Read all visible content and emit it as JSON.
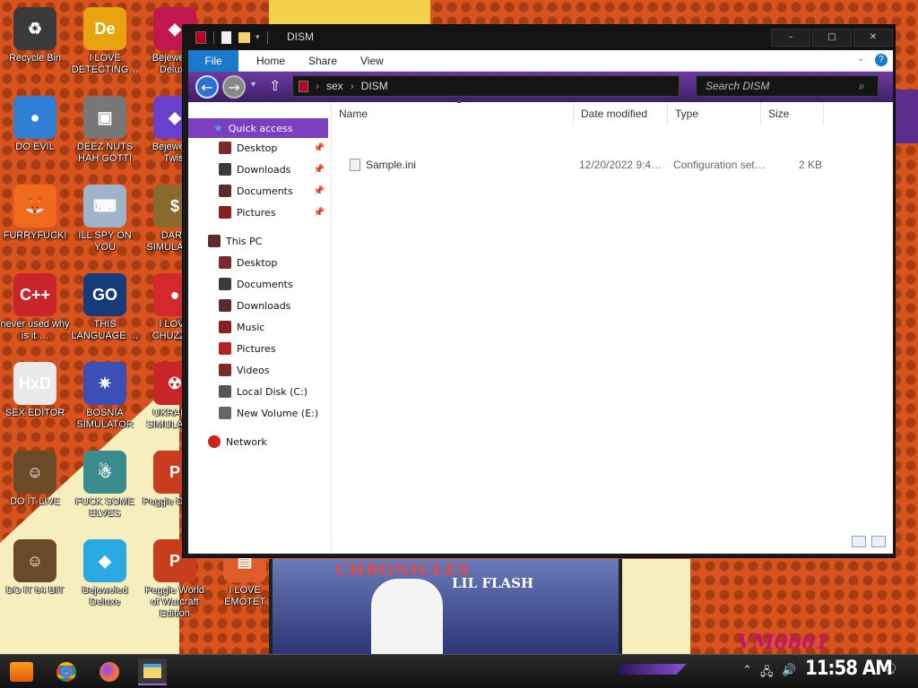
{
  "desktop": {
    "icons": [
      {
        "label": "Recycle Bin",
        "glyph": "♻",
        "color": "#3a3a3a"
      },
      {
        "label": "I LOVE DETECTING…",
        "glyph": "De",
        "color": "#e8a30f"
      },
      {
        "label": "Bejeweled Deluxe",
        "glyph": "◆",
        "color": "#c4164e"
      },
      {
        "label": "DO EVIL",
        "glyph": "●",
        "color": "#2f7fd6"
      },
      {
        "label": "DEEZ NUTS HAH GOTTI",
        "glyph": "▣",
        "color": "#777777"
      },
      {
        "label": "Bejeweled Twist",
        "glyph": "◆",
        "color": "#6a3fc9"
      },
      {
        "label": "FURRYFUCK!",
        "glyph": "🦊",
        "color": "#ef6a1c"
      },
      {
        "label": "ILL SPY ON YOU",
        "glyph": "⌨",
        "color": "#9fb4c8"
      },
      {
        "label": "DARK SIMULATOR",
        "glyph": "$",
        "color": "#8a6a2c"
      },
      {
        "label": "never used why is it …",
        "glyph": "C++",
        "color": "#c8242a"
      },
      {
        "label": "THIS LANGUAGE …",
        "glyph": "GO",
        "color": "#173a7a"
      },
      {
        "label": "I LOVE CHUZZLE",
        "glyph": "●",
        "color": "#d4282c"
      },
      {
        "label": "SEX EDITOR",
        "glyph": "HxD",
        "color": "#e9e9e9"
      },
      {
        "label": "BOSNIA SIMULATOR",
        "glyph": "✷",
        "color": "#3b4fb7"
      },
      {
        "label": "UKRAINE SIMULATOR",
        "glyph": "☢",
        "color": "#c8242a"
      },
      {
        "label": "DO IT LIVE",
        "glyph": "☺",
        "color": "#6b4a2a"
      },
      {
        "label": "FUCK SOME ELVES",
        "glyph": "☃",
        "color": "#3a8b8e"
      },
      {
        "label": "Peggle Deluxe",
        "glyph": "P",
        "color": "#c93c1e"
      },
      {
        "label": "DO IT 64 BIT",
        "glyph": "☺",
        "color": "#6b4a2a"
      },
      {
        "label": "Bejeweled Deluxe",
        "glyph": "◆",
        "color": "#29a9e1"
      },
      {
        "label": "Peggle World of Warcraft Edition",
        "glyph": "P",
        "color": "#c93c1e"
      },
      {
        "label": "I LOVE EMOTET",
        "glyph": "▤",
        "color": "#e05a2a"
      }
    ]
  },
  "window": {
    "title": "DISM",
    "controls": {
      "minimize": "–",
      "maximize": "□",
      "close": "✕"
    },
    "ribbon_tabs": [
      "File",
      "Home",
      "Share",
      "View"
    ],
    "address": {
      "segments": [
        "sex",
        "DISM"
      ],
      "separator": "›"
    },
    "search_placeholder": "Search DISM",
    "nav": {
      "quick_access": "Quick access",
      "quick_items": [
        "Desktop",
        "Downloads",
        "Documents",
        "Pictures"
      ],
      "this_pc": "This PC",
      "pc_items": [
        "Desktop",
        "Documents",
        "Downloads",
        "Music",
        "Pictures",
        "Videos",
        "Local Disk (C:)",
        "New Volume (E:)"
      ],
      "network": "Network"
    },
    "columns": [
      "Name",
      "Date modified",
      "Type",
      "Size"
    ],
    "files": [
      {
        "name": "Sample.ini",
        "date": "12/20/2022 9:4…",
        "type": "Configuration set…",
        "size": "2 KB"
      }
    ]
  },
  "wallpaper": {
    "title": "CHRONICLES",
    "subtitle": "LIL FLASH",
    "watermark": "VM0b01"
  },
  "taskbar": {
    "clock": "11:58 AM"
  },
  "colors": {
    "accent": "#7b3fbf",
    "file_tab": "#1979ca",
    "desktop": "#d9531e"
  }
}
